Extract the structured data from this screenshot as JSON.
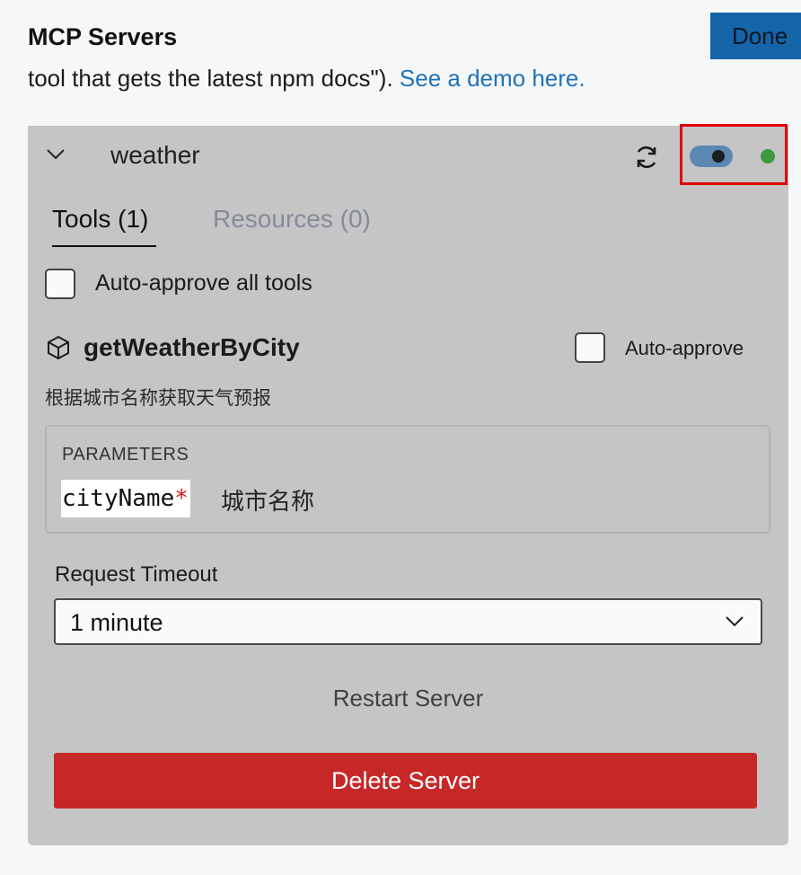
{
  "header": {
    "title": "MCP Servers",
    "done_label": "Done"
  },
  "intro": {
    "text": "tool that gets the latest npm docs\").",
    "link_text": "See a demo here."
  },
  "server": {
    "name": "weather",
    "enabled": true,
    "status_color": "#3c9a3c",
    "icons": {
      "collapse": "chevron-down-icon",
      "refresh": "refresh-icon",
      "tool": "cube-icon"
    },
    "tabs": [
      {
        "label": "Tools (1)",
        "active": true
      },
      {
        "label": "Resources (0)",
        "active": false
      }
    ],
    "auto_approve_all_label": "Auto-approve all tools",
    "auto_approve_all_checked": false,
    "tools": [
      {
        "name": "getWeatherByCity",
        "auto_approve_label": "Auto-approve",
        "auto_approve_checked": false,
        "description": "根据城市名称获取天气预报",
        "parameters_title": "PARAMETERS",
        "parameters": [
          {
            "name": "cityName",
            "required_mark": "*",
            "description": "城市名称"
          }
        ]
      }
    ],
    "timeout": {
      "label": "Request Timeout",
      "value": "1 minute"
    },
    "restart_label": "Restart Server",
    "delete_label": "Delete Server"
  },
  "colors": {
    "accent": "#1565a8",
    "link": "#1e73b8",
    "danger": "#c62828",
    "highlight": "#e00000",
    "card_bg": "#c5c5c5"
  }
}
